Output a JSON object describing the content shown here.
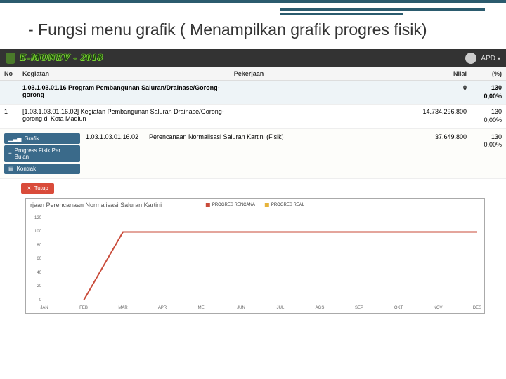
{
  "page_title": "- Fungsi menu grafik ( Menampilkan grafik progres fisik)",
  "brand": "E-MONEV - 2018",
  "user": {
    "label": "APD",
    "chev": "▾"
  },
  "columns": {
    "no": "No",
    "kegiatan": "Kegiatan",
    "pekerjaan": "Pekerjaan",
    "nilai": "Nilai",
    "pct": "(%)"
  },
  "program": {
    "name": "1.03.1.03.01.16 Program Pembangunan Saluran/Drainase/Gorong-gorong",
    "nilai": "0",
    "count": "130",
    "pct": "0,00%"
  },
  "kegiatan": {
    "no": "1",
    "name": "[1.03.1.03.01.16.02] Kegiatan Pembangunan Saluran Drainase/Gorong-gorong di Kota Madiun",
    "nilai": "14.734.296.800",
    "count": "130",
    "pct": "0,00%"
  },
  "buttons": {
    "grafik": "Grafik",
    "progress": "Progress Fisik Per Bulan",
    "kontrak": "Kontrak",
    "tutup": "Tutup"
  },
  "detail": {
    "code": "1.03.1.03.01.16.02",
    "desc": "Perencanaan Normalisasi Saluran Kartini (Fisik)",
    "nilai": "37.649.800",
    "count": "130",
    "pct": "0,00%"
  },
  "chart_data": {
    "type": "line",
    "title": "rjaan Perencanaan Normalisasi Saluran Kartini",
    "legend": [
      "PROGRES RENCANA",
      "PROGRES REAL"
    ],
    "x": [
      "JAN",
      "FEB",
      "MAR",
      "APR",
      "MEI",
      "JUN",
      "JUL",
      "AGS",
      "SEP",
      "OKT",
      "NOV",
      "DES"
    ],
    "y_ticks": [
      0,
      20,
      40,
      60,
      80,
      100,
      120
    ],
    "ylim": [
      0,
      120
    ],
    "series": [
      {
        "name": "PROGRES RENCANA",
        "color": "#c94b3a",
        "values": [
          0,
          0,
          100,
          100,
          100,
          100,
          100,
          100,
          100,
          100,
          100,
          100
        ]
      },
      {
        "name": "PROGRES REAL",
        "color": "#e6b33a",
        "values": [
          0,
          0,
          0,
          0,
          0,
          0,
          0,
          0,
          0,
          0,
          0,
          0
        ]
      }
    ]
  }
}
